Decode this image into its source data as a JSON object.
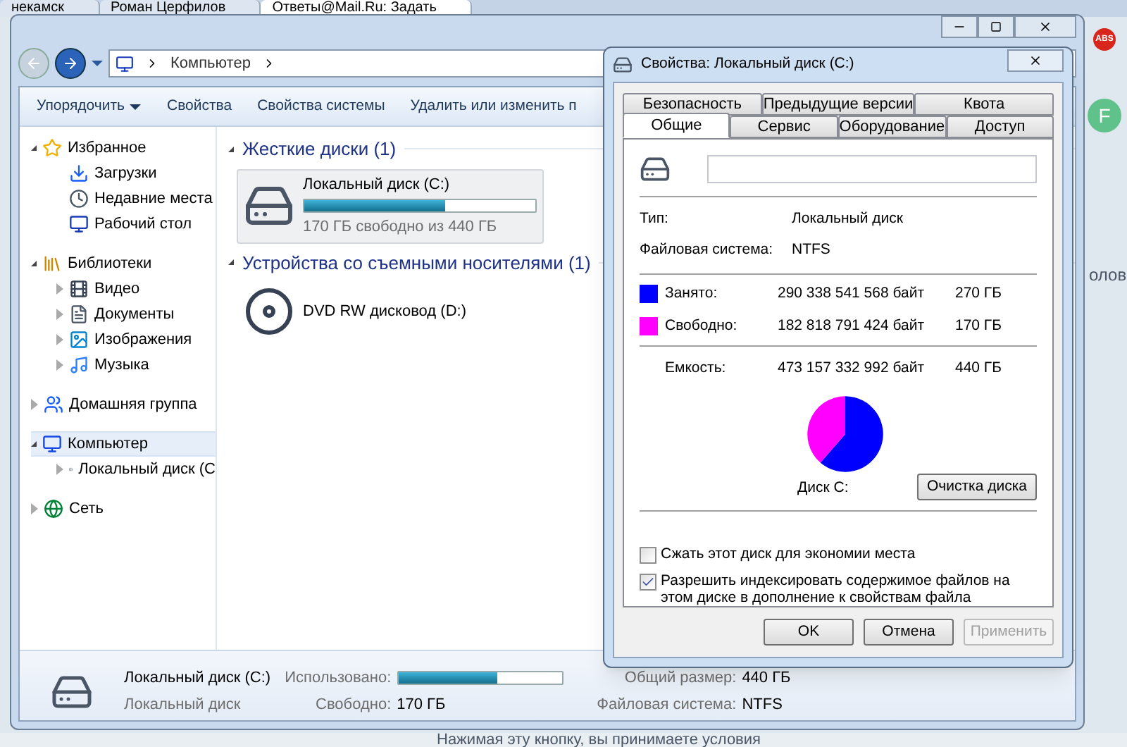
{
  "browser": {
    "tabs": [
      {
        "label": "некамск",
        "selected": false
      },
      {
        "label": "Роман Церфилов",
        "selected": false
      },
      {
        "label": "Ответы@Mail.Ru: Задать",
        "selected": true
      }
    ],
    "badge": "ABS",
    "avatar": "F",
    "side_text": "олов",
    "bottom_text": "Нажимая эту кнопку, вы принимаете условия"
  },
  "explorer": {
    "breadcrumb": [
      "Компьютер"
    ],
    "toolbar": [
      {
        "label": "Упорядочить",
        "kind": "menu"
      },
      {
        "label": "Свойства",
        "kind": "button"
      },
      {
        "label": "Свойства системы",
        "kind": "button"
      },
      {
        "label": "Удалить или изменить п",
        "kind": "button"
      }
    ],
    "sidebar": [
      {
        "label": "Избранное",
        "kind": "node",
        "expanded": true,
        "selected": false,
        "children": [
          {
            "label": "Загрузки",
            "kind": "leaf",
            "selected": false
          },
          {
            "label": "Недавние места",
            "kind": "leaf",
            "selected": false
          },
          {
            "label": "Рабочий стол",
            "kind": "leaf",
            "selected": false
          }
        ]
      },
      {
        "label": "Библиотеки",
        "kind": "node",
        "expanded": true,
        "selected": false,
        "children": [
          {
            "label": "Видео",
            "kind": "node",
            "expanded": false,
            "selected": false
          },
          {
            "label": "Документы",
            "kind": "node",
            "expanded": false,
            "selected": false
          },
          {
            "label": "Изображения",
            "kind": "node",
            "expanded": false,
            "selected": false
          },
          {
            "label": "Музыка",
            "kind": "node",
            "expanded": false,
            "selected": false
          }
        ]
      },
      {
        "label": "Домашняя группа",
        "kind": "node",
        "expanded": false,
        "selected": false
      },
      {
        "label": "Компьютер",
        "kind": "node",
        "expanded": true,
        "selected": true,
        "children": [
          {
            "label": "Локальный диск (С",
            "kind": "node",
            "expanded": false,
            "selected": false
          }
        ]
      },
      {
        "label": "Сеть",
        "kind": "node",
        "expanded": false,
        "selected": false
      }
    ],
    "groups": [
      {
        "title": "Жесткие диски (1)",
        "items": [
          {
            "name": "Локальный диск (C:)",
            "kind": "hdd",
            "level": 0.61,
            "detail": "170 ГБ свободно из 440 ГБ",
            "selected": true
          }
        ]
      },
      {
        "title": "Устройства со съемными носителями (1)",
        "items": [
          {
            "name": "DVD RW дисковод (D:)",
            "kind": "dvd",
            "selected": false
          }
        ]
      }
    ],
    "details": {
      "name": "Локальный диск (C:)",
      "type": "Локальный диск",
      "used_label": "Использовано:",
      "level": 0.61,
      "free_label": "Свободно:",
      "free_value": "170 ГБ",
      "total_label": "Общий размер:",
      "total_value": "440 ГБ",
      "fs_label": "Файловая система:",
      "fs_value": "NTFS"
    }
  },
  "dialog": {
    "title": "Свойства: Локальный диск (C:)",
    "tab_rows": [
      [
        {
          "label": "Безопасность",
          "selected": false
        },
        {
          "label": "Предыдущие версии",
          "selected": false
        },
        {
          "label": "Квота",
          "selected": false
        }
      ],
      [
        {
          "label": "Общие",
          "selected": true
        },
        {
          "label": "Сервис",
          "selected": false
        },
        {
          "label": "Оборудование",
          "selected": false
        },
        {
          "label": "Доступ",
          "selected": false
        }
      ]
    ],
    "type_label": "Тип:",
    "type_value": "Локальный диск",
    "fs_label": "Файловая система:",
    "fs_value": "NTFS",
    "usage": [
      {
        "label": "Занято:",
        "bytes": "290 338 541 568 байт",
        "size": "270 ГБ",
        "color": "#0000ff"
      },
      {
        "label": "Свободно:",
        "bytes": "182 818 791 424 байт",
        "size": "170 ГБ",
        "color": "#ff00ff"
      }
    ],
    "capacity": {
      "label": "Емкость:",
      "bytes": "473 157 332 992 байт",
      "size": "440 ГБ"
    },
    "chart_data": {
      "type": "pie",
      "title": "Диск C:",
      "values": [
        61.4,
        38.6
      ]
    },
    "cleanup": "Очистка диска",
    "options": [
      {
        "label": "Сжать этот диск для экономии места",
        "checked": false
      },
      {
        "label": "Разрешить индексировать содержимое файлов на этом диске в дополнение к свойствам файла",
        "checked": true
      }
    ],
    "buttons": [
      {
        "label": "OK",
        "disabled": false
      },
      {
        "label": "Отмена",
        "disabled": false
      },
      {
        "label": "Применить",
        "disabled": true
      }
    ]
  }
}
